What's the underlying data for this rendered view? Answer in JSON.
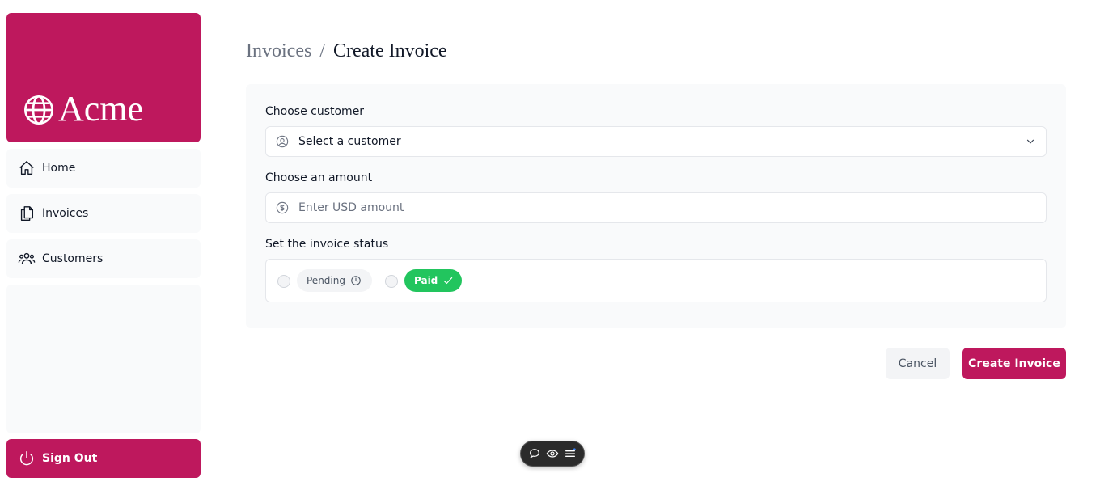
{
  "brand": {
    "name": "Acme",
    "color": "#be185d",
    "icon": "globe-icon"
  },
  "sidebar": {
    "items": [
      {
        "label": "Home",
        "icon": "home-icon"
      },
      {
        "label": "Invoices",
        "icon": "document-duplicate-icon"
      },
      {
        "label": "Customers",
        "icon": "user-group-icon"
      }
    ],
    "sign_out": {
      "label": "Sign Out",
      "icon": "power-icon"
    }
  },
  "breadcrumb": {
    "parent": "Invoices",
    "separator": "/",
    "current": "Create Invoice"
  },
  "form": {
    "customer": {
      "label": "Choose customer",
      "value": "Select a customer",
      "icon": "user-circle-icon"
    },
    "amount": {
      "label": "Choose an amount",
      "placeholder": "Enter USD amount",
      "icon": "currency-dollar-icon"
    },
    "status": {
      "label": "Set the invoice status",
      "options": [
        {
          "label": "Pending",
          "icon": "clock-icon"
        },
        {
          "label": "Paid",
          "icon": "check-icon",
          "color": "#22c55e"
        }
      ]
    }
  },
  "actions": {
    "cancel": "Cancel",
    "create": "Create Invoice"
  },
  "dev_toolbar": {
    "icons": [
      "chat-bubble-icon",
      "eye-icon",
      "menu-icon"
    ]
  }
}
